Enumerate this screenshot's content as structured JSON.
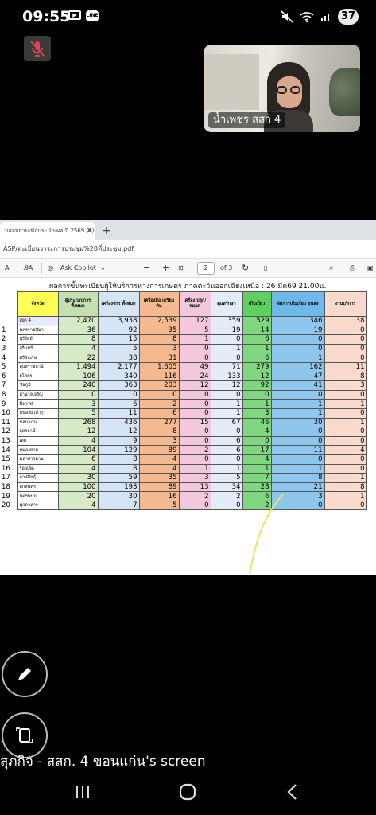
{
  "status_bar": {
    "time": "09:55",
    "notif_icon_label": "LINE",
    "battery": "37"
  },
  "video_tile": {
    "participant_name": "น้ำเพชร สสก 4"
  },
  "browser": {
    "tab_title": "บสอบถามเพื่อประเมินผล ปี 2569 (4)",
    "url": "ASP/ทะเบียนวาระการประชุม%20ที่ประชุม.pdf",
    "toolbar": {
      "ask_copilot": "Ask Copilot",
      "zoom_minus": "−",
      "zoom_plus": "+",
      "page_current": "2",
      "page_total": "of 3",
      "read_aloud": "A",
      "translate": "ᎯA"
    }
  },
  "document": {
    "title": "ผลการขึ้นทะเบียนผู้ให้บริการทางการเกษตร ภาคตะวันออกเฉียงเหนือ : 26 มีค69 21.00น.",
    "headers": {
      "province": "จังหวัด",
      "col1": "ผู้ประกอบการ ทั้งหมด",
      "col2": "เครื่องจักร ทั้งหมด",
      "col3": "เครื่องมือ เตรียมดิน",
      "col4": "เครื่อง ปลูก/หยอด",
      "col5": "ดูแลรักษา",
      "col6": "เก็บเกี่ยว",
      "col7": "จัดการเก็บเกี่ยว ขนส่ง",
      "col8": "งานบริการ"
    },
    "rows": [
      {
        "num": "",
        "name": "เขต 4",
        "v": [
          "2,470",
          "3,938",
          "2,539",
          "127",
          "359",
          "529",
          "346",
          "38"
        ]
      },
      {
        "num": "1",
        "name": "นครราชสีมา",
        "v": [
          "36",
          "92",
          "35",
          "5",
          "19",
          "14",
          "19",
          "0"
        ]
      },
      {
        "num": "2",
        "name": "บุรีรัมย์",
        "v": [
          "8",
          "15",
          "8",
          "1",
          "0",
          "6",
          "0",
          "0"
        ]
      },
      {
        "num": "3",
        "name": "สุรินทร์",
        "v": [
          "4",
          "5",
          "3",
          "0",
          "1",
          "1",
          "0",
          "0"
        ]
      },
      {
        "num": "4",
        "name": "ศรีสะเกษ",
        "v": [
          "22",
          "38",
          "31",
          "0",
          "0",
          "6",
          "1",
          "0"
        ]
      },
      {
        "num": "5",
        "name": "อุบลราชธานี",
        "v": [
          "1,494",
          "2,177",
          "1,605",
          "49",
          "71",
          "279",
          "162",
          "11"
        ]
      },
      {
        "num": "6",
        "name": "ยโสธร",
        "v": [
          "106",
          "340",
          "116",
          "24",
          "133",
          "12",
          "47",
          "8"
        ]
      },
      {
        "num": "7",
        "name": "ชัยภูมิ",
        "v": [
          "240",
          "363",
          "203",
          "12",
          "12",
          "92",
          "41",
          "3"
        ]
      },
      {
        "num": "8",
        "name": "อำนาจเจริญ",
        "v": [
          "0",
          "0",
          "0",
          "0",
          "0",
          "0",
          "0",
          "0"
        ]
      },
      {
        "num": "9",
        "name": "บึงกาฬ",
        "v": [
          "3",
          "6",
          "2",
          "0",
          "1",
          "1",
          "1",
          "1"
        ]
      },
      {
        "num": "10",
        "name": "หนองบัวลำภู",
        "v": [
          "5",
          "11",
          "6",
          "0",
          "1",
          "3",
          "1",
          "0"
        ]
      },
      {
        "num": "11",
        "name": "ขอนแก่น",
        "v": [
          "268",
          "436",
          "277",
          "15",
          "67",
          "46",
          "30",
          "1"
        ]
      },
      {
        "num": "12",
        "name": "อุดรธานี",
        "v": [
          "12",
          "12",
          "8",
          "0",
          "0",
          "4",
          "0",
          "0"
        ]
      },
      {
        "num": "13",
        "name": "เลย",
        "v": [
          "4",
          "9",
          "3",
          "0",
          "6",
          "0",
          "0",
          "0"
        ]
      },
      {
        "num": "14",
        "name": "หนองคาย",
        "v": [
          "104",
          "129",
          "89",
          "2",
          "6",
          "17",
          "11",
          "4"
        ]
      },
      {
        "num": "15",
        "name": "มหาสารคาม",
        "v": [
          "6",
          "8",
          "4",
          "0",
          "0",
          "4",
          "0",
          "0"
        ]
      },
      {
        "num": "16",
        "name": "ร้อยเอ็ด",
        "v": [
          "4",
          "8",
          "4",
          "1",
          "1",
          "1",
          "1",
          "0"
        ]
      },
      {
        "num": "17",
        "name": "กาฬสินธุ์",
        "v": [
          "30",
          "59",
          "35",
          "3",
          "5",
          "7",
          "8",
          "1"
        ]
      },
      {
        "num": "18",
        "name": "สกลนคร",
        "v": [
          "100",
          "193",
          "89",
          "13",
          "34",
          "28",
          "21",
          "8"
        ]
      },
      {
        "num": "19",
        "name": "นครพนม",
        "v": [
          "20",
          "30",
          "16",
          "2",
          "2",
          "6",
          "3",
          "1"
        ]
      },
      {
        "num": "20",
        "name": "มุกดาหาร",
        "v": [
          "4",
          "7",
          "5",
          "0",
          "0",
          "2",
          "0",
          "0"
        ]
      }
    ]
  },
  "screen_share_label": "สุภกิจ - สสก. 4 ขอนแก่น's screen",
  "icons": {
    "mic": "mic-off-icon",
    "edit": "pencil-icon",
    "rotate": "rotate-screen-icon",
    "nav_recent": "recent-apps-icon",
    "nav_home": "home-icon",
    "nav_back": "back-icon"
  },
  "colors": {
    "mic_off": "#e0454f",
    "annotation_stroke": "#e6e86a"
  }
}
